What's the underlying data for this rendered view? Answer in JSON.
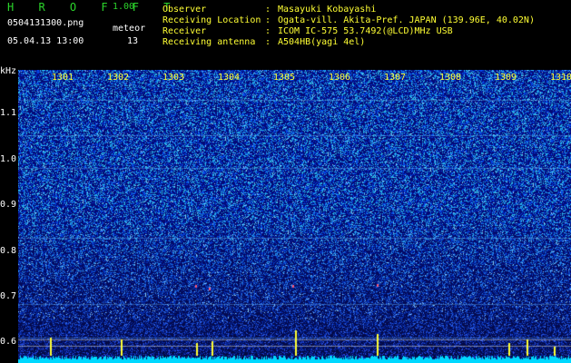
{
  "header": {
    "app_title": "H R O F F T",
    "version": "1.00",
    "filename": "0504131300.png",
    "meteor_label": "meteor",
    "meteor_count": "13",
    "datetime": "05.04.13 13:00"
  },
  "info": [
    {
      "label": "Observer",
      "value": "Masayuki Kobayashi"
    },
    {
      "label": "Receiving Location",
      "value": "Ogata-vill. Akita-Pref. JAPAN (139.96E, 40.02N)"
    },
    {
      "label": "Receiver",
      "value": "ICOM IC-575 53.7492(@LCD)MHz USB"
    },
    {
      "label": "Receiving antenna",
      "value": "A504HB(yagi 4el)"
    }
  ],
  "y_axis": {
    "unit": "kHz",
    "ticks": [
      "1.1",
      "1.0",
      "0.9",
      "0.8",
      "0.7",
      "0.6"
    ]
  },
  "x_axis": {
    "ticks": [
      "1301",
      "1302",
      "1303",
      "1304",
      "1305",
      "1306",
      "1307",
      "1308",
      "1309",
      "1310"
    ]
  },
  "colors": {
    "background": "#000000",
    "spectrogram_base": "#0a1a8c",
    "noise_bright": "#3fa0ff",
    "signal": "#ffff33",
    "baseline": "#00e0ff",
    "title_green": "#2bd42b"
  }
}
